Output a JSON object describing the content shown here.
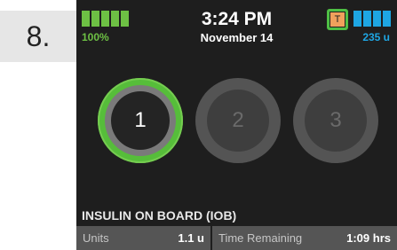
{
  "step": {
    "number": "8."
  },
  "status_bar": {
    "battery_percent": "100%",
    "battery_level": 1.0,
    "battery_color": "#6dc044",
    "time": "3:24 PM",
    "date": "November 14",
    "temp_rate_badge": "T",
    "temp_rate_color": "#f0a15c",
    "cartridge_units": "235 u",
    "cartridge_color": "#1ea6e3"
  },
  "profiles": {
    "items": [
      {
        "label": "1",
        "state": "active"
      },
      {
        "label": "2",
        "state": "inactive"
      },
      {
        "label": "3",
        "state": "inactive"
      }
    ]
  },
  "iob": {
    "title": "INSULIN ON BOARD (IOB)",
    "units_label": "Units",
    "units_value": "1.1 u",
    "time_label": "Time Remaining",
    "time_value": "1:09 hrs"
  },
  "colors": {
    "active_ring": "#56bd3a",
    "background": "#1e1e1e"
  }
}
